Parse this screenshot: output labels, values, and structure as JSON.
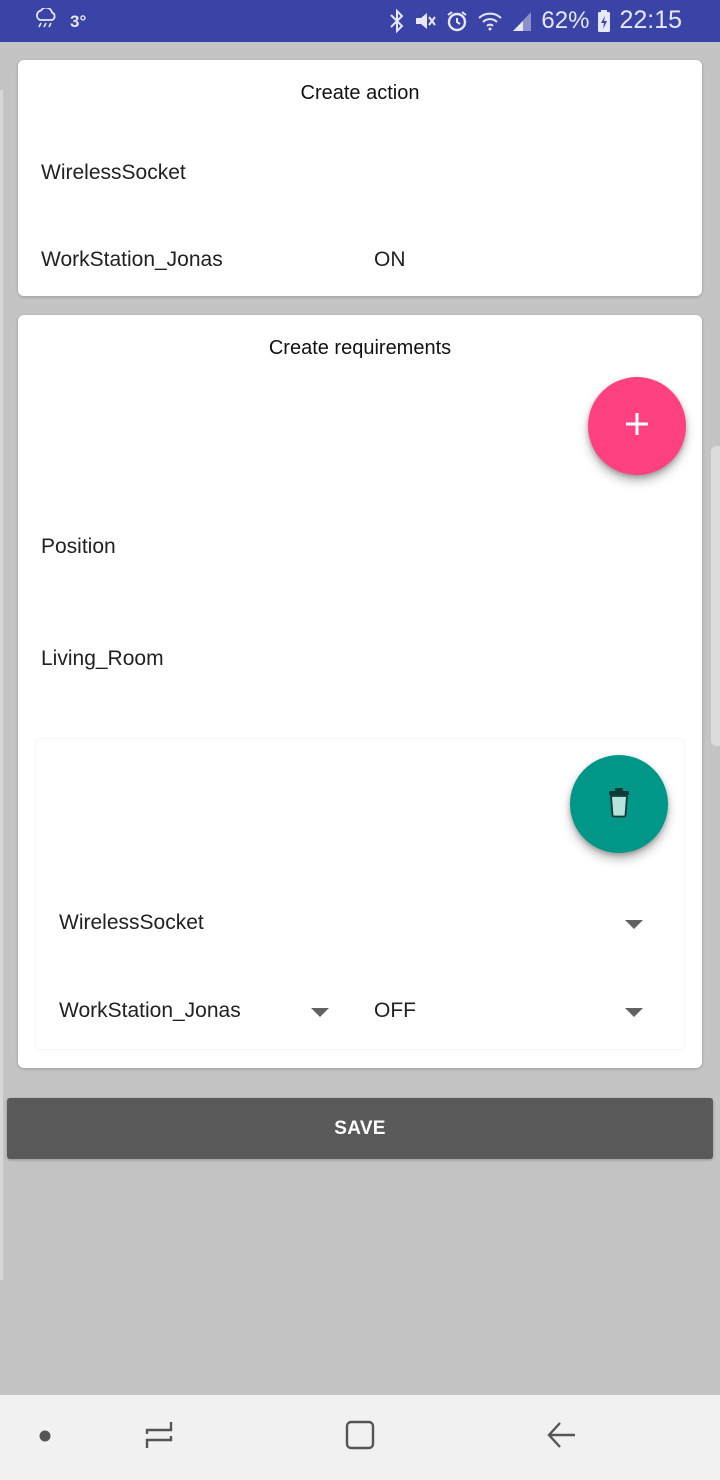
{
  "status_bar": {
    "temperature": "3°",
    "battery": "62%",
    "time": "22:15",
    "icons": [
      "cloud-rain-icon",
      "bluetooth-icon",
      "mute-icon",
      "alarm-icon",
      "wifi-icon",
      "signal-icon",
      "battery-icon"
    ]
  },
  "action_card": {
    "title": "Create action",
    "device": "WirelessSocket",
    "name": "WorkStation_Jonas",
    "state": "ON"
  },
  "requirements_card": {
    "title": "Create requirements",
    "add_button_icon": "plus-icon",
    "field_label": "Position",
    "field_value": "Living_Room",
    "requirement": {
      "delete_button_icon": "trash-icon",
      "device_spinner": "WirelessSocket",
      "name_spinner": "WorkStation_Jonas",
      "state_spinner": "OFF"
    }
  },
  "save_button": {
    "label": "SAVE"
  },
  "nav_bar": {
    "icons": [
      "dot-icon",
      "recent-apps-icon",
      "home-icon",
      "back-icon"
    ]
  },
  "colors": {
    "status_bar": "#3a44a6",
    "fab_add": "#ff4081",
    "fab_delete": "#009688",
    "save_button": "#595959",
    "background": "#c4c4c4"
  }
}
